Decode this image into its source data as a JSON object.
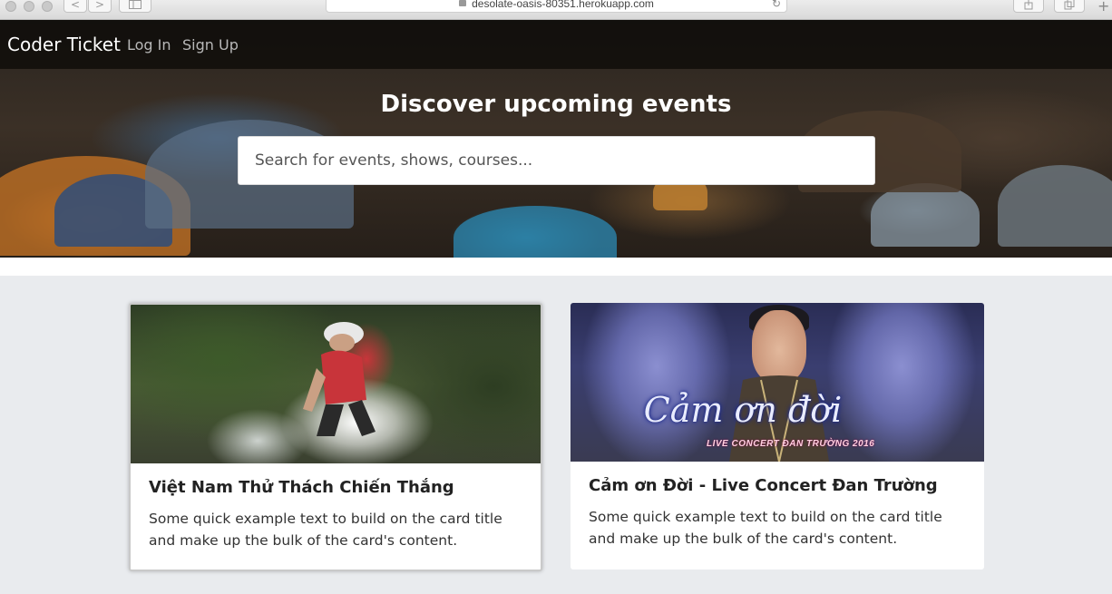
{
  "browser": {
    "url": "desolate-oasis-80351.herokuapp.com",
    "icons": [
      "back-icon",
      "forward-icon",
      "sidebar-icon",
      "lock-icon",
      "reload-icon",
      "share-icon",
      "tabs-icon",
      "new-tab-icon"
    ],
    "back_glyph": "<",
    "forward_glyph": ">",
    "reload_glyph": "↻",
    "new_tab_glyph": "+"
  },
  "nav": {
    "brand": "Coder Ticket",
    "login": "Log In",
    "signup": "Sign Up"
  },
  "hero": {
    "title": "Discover upcoming events",
    "search_placeholder": "Search for events, shows, courses..."
  },
  "events": [
    {
      "title": "Việt Nam Thử Thách Chiến Thắng",
      "text": "Some quick example text to build on the card title and make up the bulk of the card's content."
    },
    {
      "title": "Cảm ơn Đời - Live Concert Đan Trường",
      "text": "Some quick example text to build on the card title and make up the bulk of the card's content.",
      "image_logo": "Cảm ơn đời",
      "image_sub": "LIVE CONCERT ĐAN TRƯỜNG 2016"
    }
  ],
  "colors": {
    "background": "#e9ebee",
    "nav_overlay": "#0a0806",
    "card": "#ffffff",
    "title_text": "#222222"
  }
}
